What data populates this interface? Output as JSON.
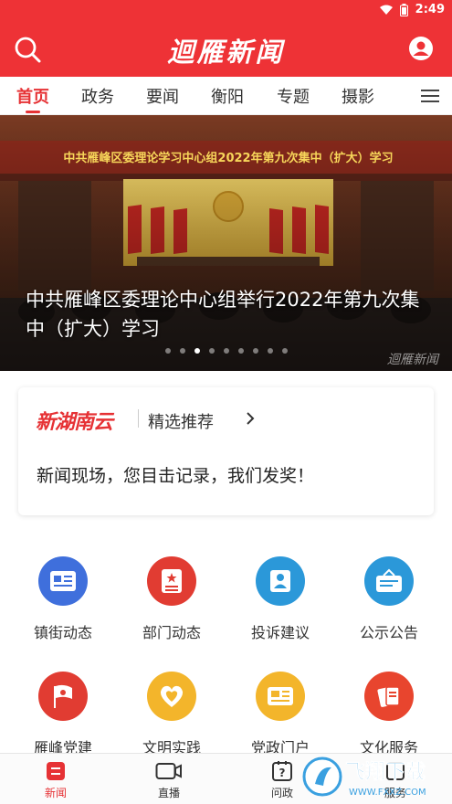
{
  "status": {
    "time": "2:49"
  },
  "header": {
    "title": "迴雁新闻",
    "search_icon": "search-icon",
    "user_icon": "user-icon"
  },
  "tabs": [
    {
      "label": "首页",
      "active": true
    },
    {
      "label": "政务"
    },
    {
      "label": "要闻"
    },
    {
      "label": "衡阳"
    },
    {
      "label": "专题"
    },
    {
      "label": "摄影"
    }
  ],
  "banner": {
    "image_text": "中共雁峰区委理论学习中心组2022年第九次集中（扩大）学习",
    "caption": "中共雁峰区委理论中心组举行2022年第九次集中（扩大）学习",
    "watermark": "迴雁新闻",
    "slide_count": 9,
    "active_slide": 3
  },
  "promo": {
    "logo": "新湖南云",
    "link_label": "精选推荐",
    "text": "新闻现场，您目击记录，我们发奖！"
  },
  "grid": [
    {
      "label": "镇街动态",
      "icon": "news-card-icon",
      "color": "#3f6fdc"
    },
    {
      "label": "部门动态",
      "icon": "document-star-icon",
      "color": "#e13c32"
    },
    {
      "label": "投诉建议",
      "icon": "service-person-icon",
      "color": "#2b98d9"
    },
    {
      "label": "公示公告",
      "icon": "notice-board-icon",
      "color": "#2b98d9"
    },
    {
      "label": "雁峰党建",
      "icon": "party-flag-icon",
      "color": "#e13c32"
    },
    {
      "label": "文明实践",
      "icon": "heart-icon",
      "color": "#f3b52b"
    },
    {
      "label": "党政门户",
      "icon": "newspaper-icon",
      "color": "#f3b52b"
    },
    {
      "label": "文化服务",
      "icon": "books-icon",
      "color": "#e8452e"
    }
  ],
  "bottom_nav": [
    {
      "label": "新闻",
      "icon": "news-icon",
      "active": true
    },
    {
      "label": "直播",
      "icon": "video-camera-icon"
    },
    {
      "label": "问政",
      "icon": "question-icon"
    },
    {
      "label": "服务",
      "icon": "service-icon"
    }
  ],
  "watermark": {
    "text": "飞翔下载",
    "url": "WWW.FXXZ.COM"
  },
  "colors": {
    "brand": "#ee3236",
    "tab_active": "#e63235"
  }
}
